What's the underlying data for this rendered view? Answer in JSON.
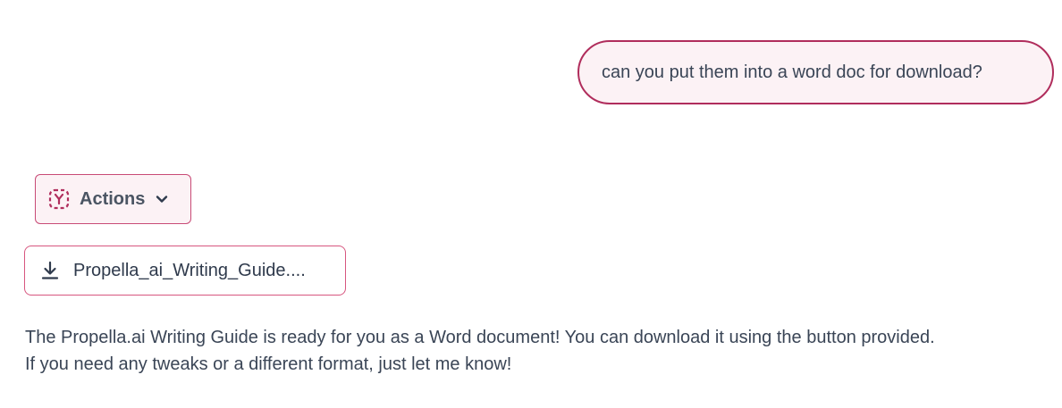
{
  "user_message": {
    "text": "can you put them into a word doc for download?"
  },
  "actions": {
    "label": "Actions",
    "icon": "actions-icon",
    "chevron_icon": "chevron-down-icon"
  },
  "download": {
    "label": "Propella_ai_Writing_Guide....",
    "icon": "download-icon"
  },
  "assistant_message": {
    "line1": "The Propella.ai Writing Guide is ready for you as a Word document! You can download it using the button provided.",
    "line2": "If you need any tweaks or a different format, just let me know!"
  },
  "colors": {
    "accent": "#b02d5c",
    "bubble_bg": "#fcf2f5",
    "text": "#3a4556"
  }
}
